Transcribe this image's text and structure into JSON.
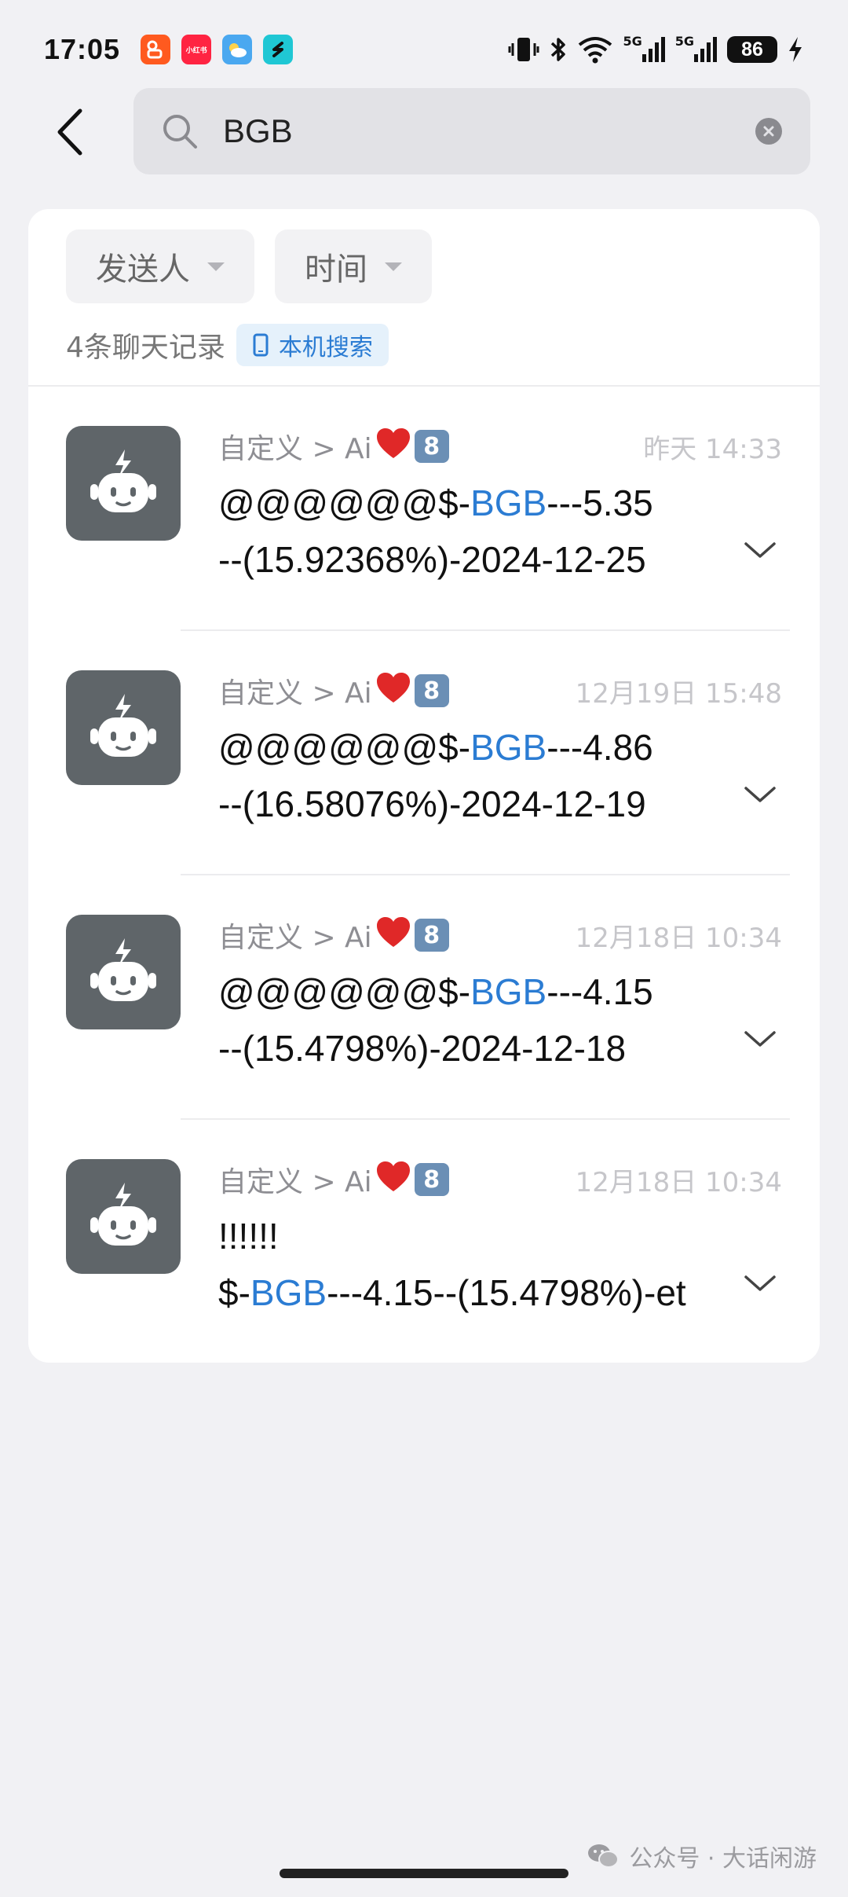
{
  "status_bar": {
    "time": "17:05",
    "apps": [
      {
        "name": "kuaishou",
        "label": "",
        "color": "#ff5a1f"
      },
      {
        "name": "xiaohongshu",
        "label": "小红书",
        "color": "#ff2442"
      },
      {
        "name": "weather",
        "label": "",
        "color": "#4aa8f0"
      },
      {
        "name": "app-s",
        "label": "",
        "color": "#1fc7d4"
      }
    ],
    "signal_label_1": "5G",
    "signal_label_2": "5G",
    "battery": "86"
  },
  "search": {
    "query": "BGB"
  },
  "filters": {
    "sender": "发送人",
    "time": "时间"
  },
  "summary": {
    "count_text": "4条聊天记录",
    "local_search": "本机搜索"
  },
  "results": [
    {
      "sender": "自定义 > Ai",
      "keycap": "8",
      "time": "昨天 14:33",
      "line1_before": "@@@@@@$-",
      "line1_hl": "BGB",
      "line1_after": "---5.35",
      "line2_before": "",
      "line2_hl": "",
      "line2_after": "--(15.92368%)-2024-12-25"
    },
    {
      "sender": "自定义 > Ai",
      "keycap": "8",
      "time": "12月19日 15:48",
      "line1_before": "@@@@@@$-",
      "line1_hl": "BGB",
      "line1_after": "---4.86",
      "line2_before": "",
      "line2_hl": "",
      "line2_after": "--(16.58076%)-2024-12-19"
    },
    {
      "sender": "自定义 > Ai",
      "keycap": "8",
      "time": "12月18日 10:34",
      "line1_before": "@@@@@@$-",
      "line1_hl": "BGB",
      "line1_after": "---4.15",
      "line2_before": "",
      "line2_hl": "",
      "line2_after": "--(15.4798%)-2024-12-18"
    },
    {
      "sender": "自定义 > Ai",
      "keycap": "8",
      "time": "12月18日 10:34",
      "line1_before": "!!!!!!",
      "line1_hl": "",
      "line1_after": "",
      "line2_before": "$-",
      "line2_hl": "BGB",
      "line2_after": "---4.15--(15.4798%)-et"
    }
  ],
  "watermark": "公众号 · 大话闲游",
  "colors": {
    "accent": "#2b7cd3",
    "avatar_bg": "#5f6569",
    "card_bg": "#ffffff",
    "page_bg": "#f1f1f4"
  }
}
